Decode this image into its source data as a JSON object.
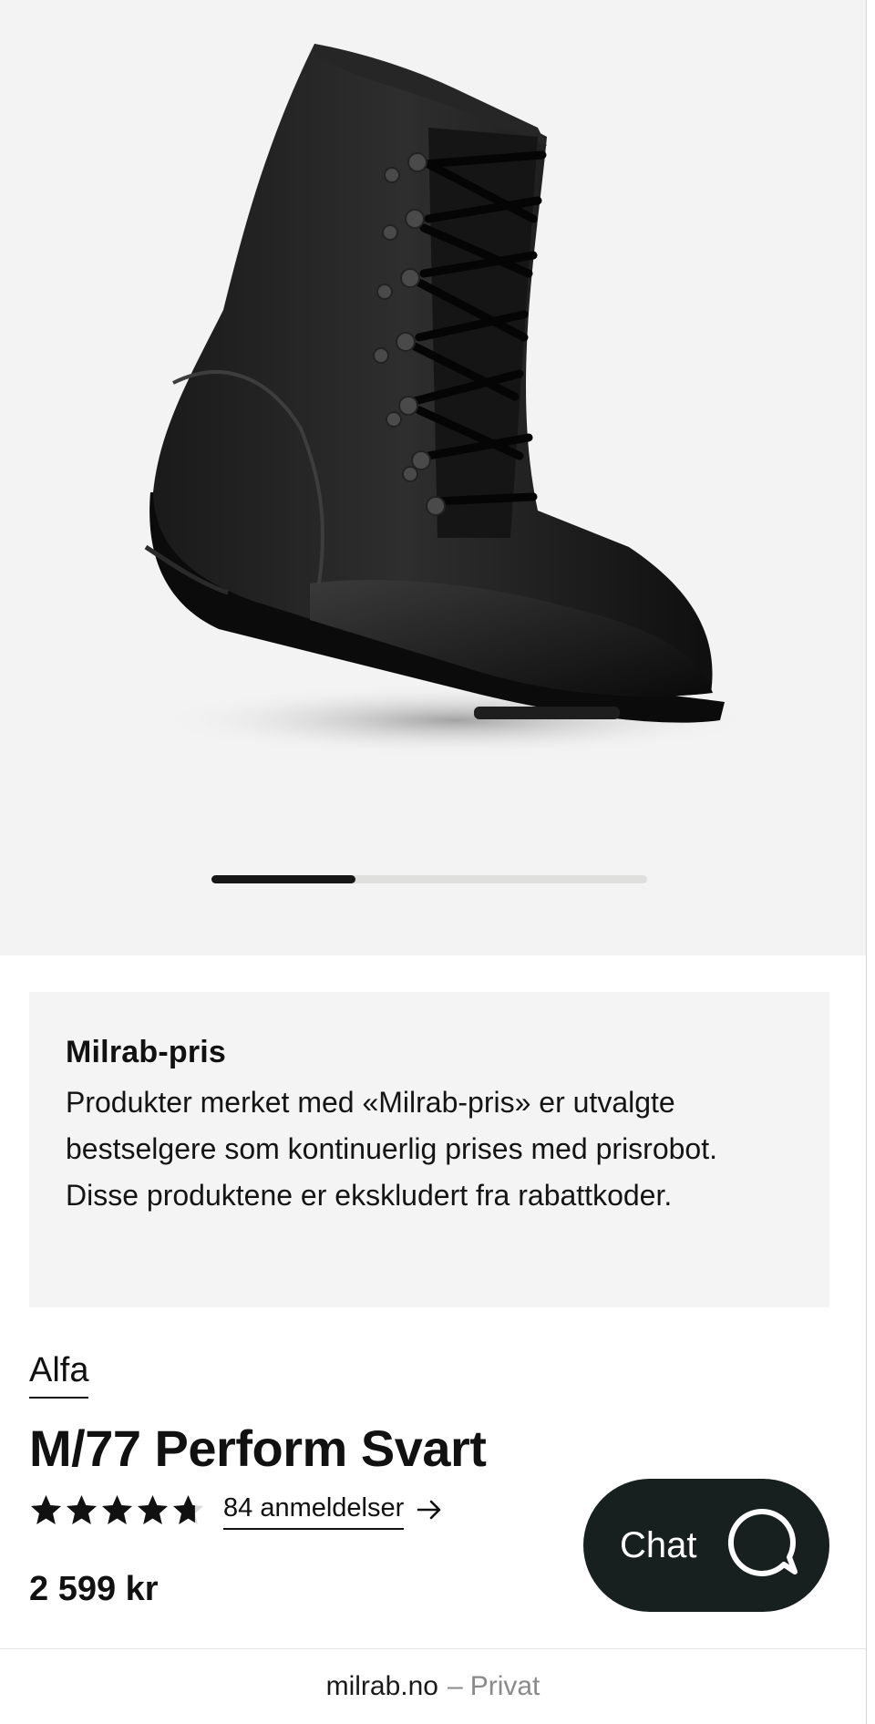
{
  "gallery": {
    "image_alt": "M/77 Perform Svart støvel",
    "slide_progress": 0.33,
    "colors": {
      "background": "#f3f3f3",
      "track": "#dfdfdd",
      "fill": "#161616"
    }
  },
  "info_box": {
    "title": "Milrab-pris",
    "text": "Produkter merket med «Milrab-pris» er utvalgte bestselgere som kontinuerlig prises med prisrobot. Disse produktene er ekskludert fra rabattkoder."
  },
  "product": {
    "brand": "Alfa",
    "title": "M/77 Perform Svart",
    "rating": 4.7,
    "rating_max": 5,
    "reviews_label": "84 anmeldelser",
    "price": "2 599 kr"
  },
  "icons": {
    "star": "star-icon",
    "arrow": "arrow-right-icon",
    "chat": "chat-bubble-icon"
  },
  "chat": {
    "label": "Chat",
    "background": "#17201e"
  },
  "urlbar": {
    "domain": "milrab.no",
    "separator": "–",
    "mode": "Privat"
  }
}
